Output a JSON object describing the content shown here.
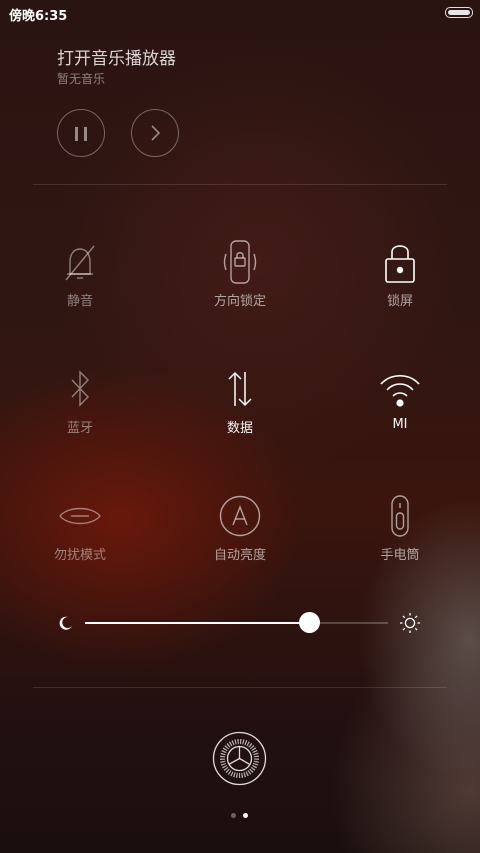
{
  "status_bar": {
    "time": "傍晚6:35",
    "battery_icon": "battery-icon"
  },
  "music": {
    "title": "打开音乐播放器",
    "subtitle": "暂无音乐",
    "pause_icon": "pause-icon",
    "next_icon": "chevron-right-icon"
  },
  "toggles": {
    "mute": {
      "label": "静音",
      "icon": "bell-off-icon",
      "active": false
    },
    "rotation_lock": {
      "label": "方向锁定",
      "icon": "rotation-lock-icon",
      "active": false
    },
    "lock_screen": {
      "label": "锁屏",
      "icon": "lock-icon",
      "active": true
    },
    "bluetooth": {
      "label": "蓝牙",
      "icon": "bluetooth-icon",
      "active": false
    },
    "data": {
      "label": "数据",
      "icon": "data-arrows-icon",
      "active": true
    },
    "wifi": {
      "label": "MI",
      "icon": "wifi-icon",
      "active": true
    },
    "dnd": {
      "label": "勿扰模式",
      "icon": "moon-eye-icon",
      "active": false
    },
    "auto_brightness": {
      "label": "自动亮度",
      "icon": "auto-brightness-icon",
      "active": false
    },
    "flashlight": {
      "label": "手电筒",
      "icon": "flashlight-icon",
      "active": false
    }
  },
  "brightness": {
    "level": 0.74,
    "low_icon": "moon-icon",
    "high_icon": "sun-icon"
  },
  "settings": {
    "icon": "settings-gear-icon"
  },
  "pagination": {
    "count": 2,
    "active_index": 1
  },
  "colors": {
    "active": "#ffffff",
    "inactive": "rgba(255,255,255,0.45)"
  }
}
